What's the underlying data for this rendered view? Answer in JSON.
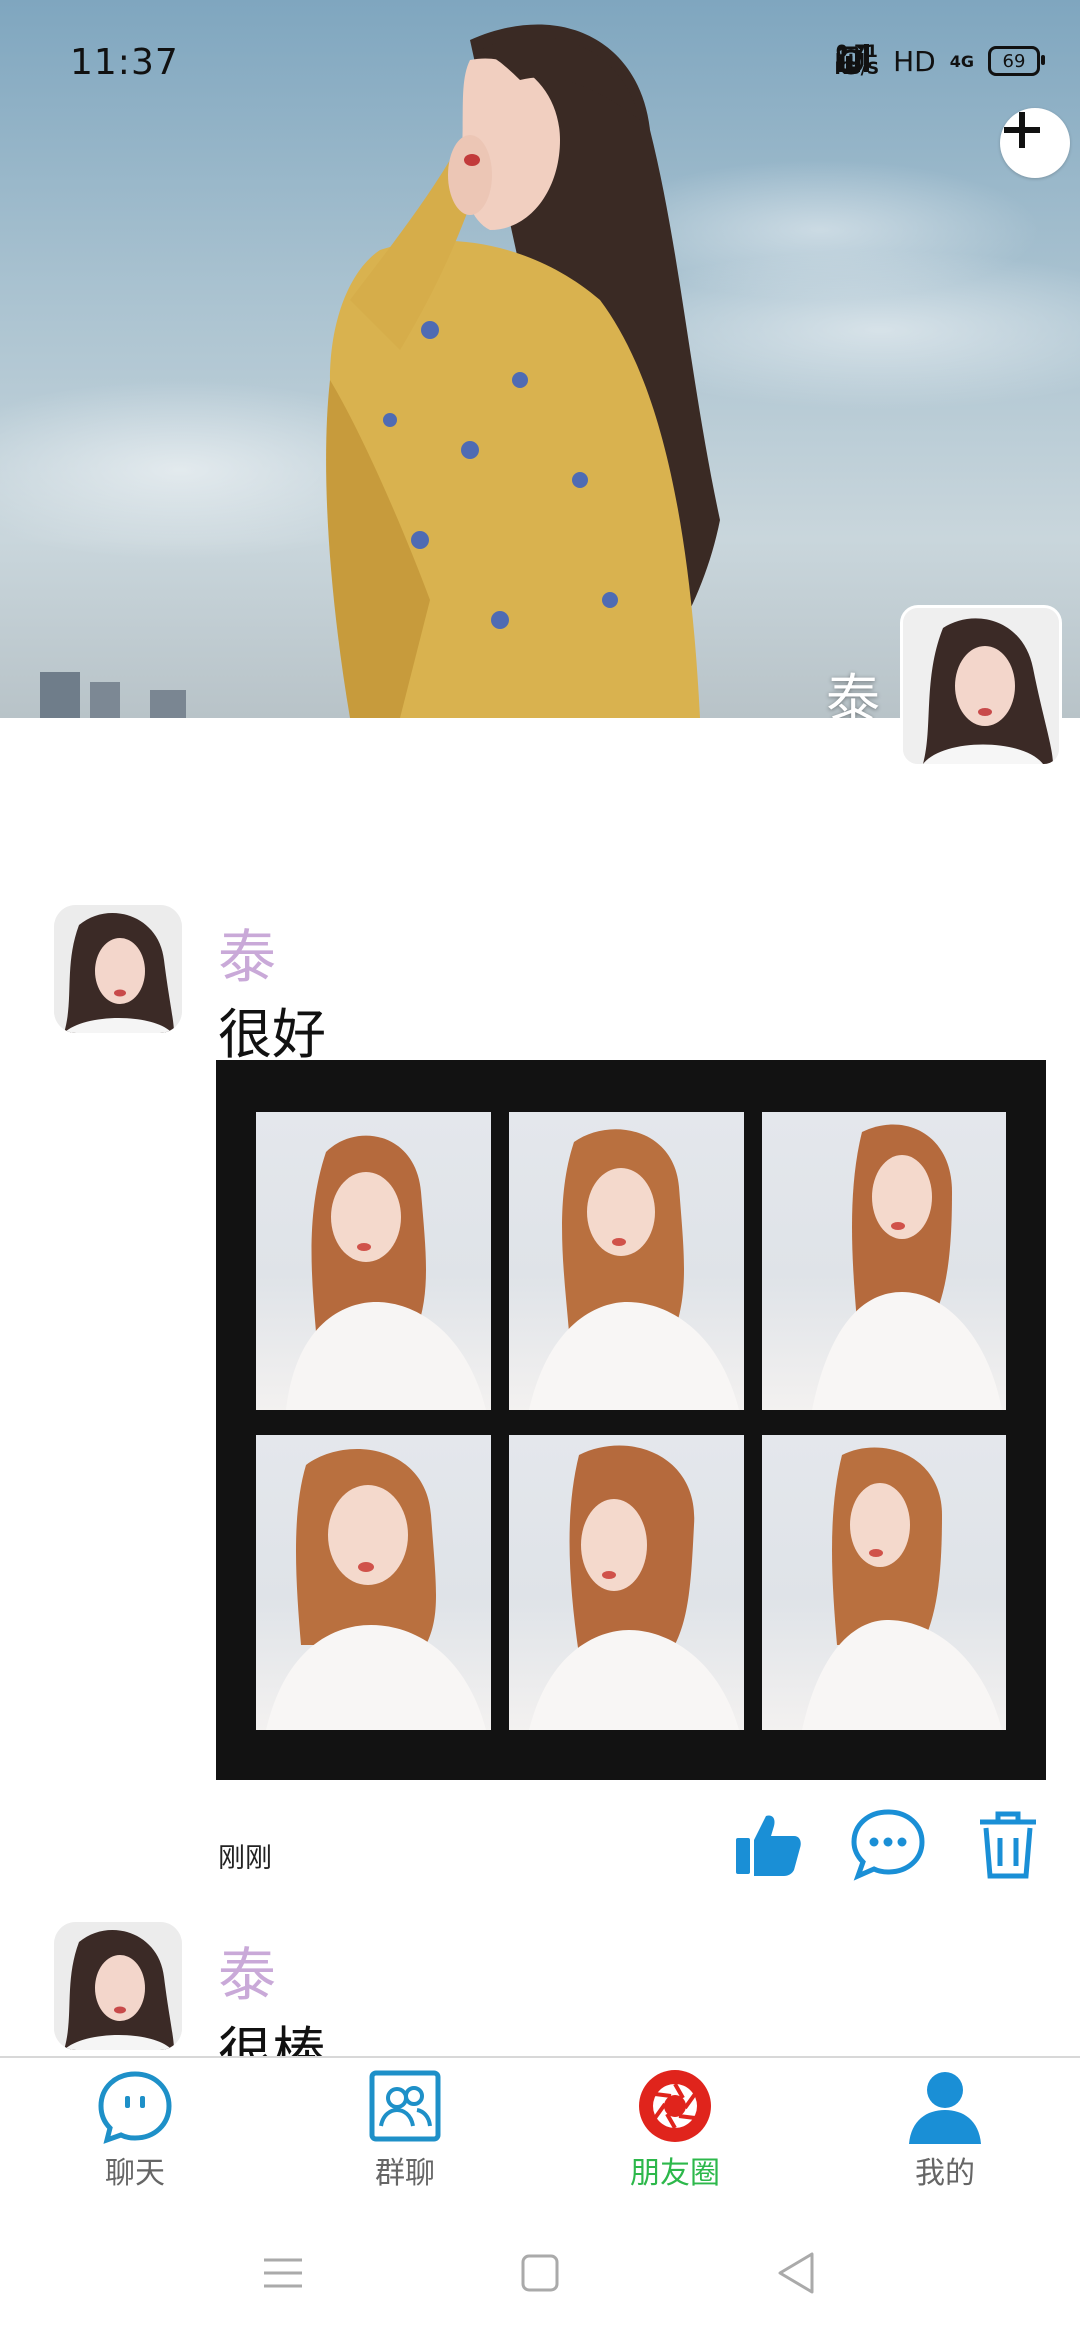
{
  "status_bar": {
    "time": "11:37",
    "net_speed_value": "0.71",
    "net_speed_unit": "KB/S",
    "hd": "HD",
    "network": "4G",
    "battery": "69"
  },
  "header": {
    "profile_name": "泰",
    "add_icon": "plus-icon"
  },
  "posts": [
    {
      "author": "泰",
      "text": "很好",
      "photos_count_shown": 6,
      "time": "刚刚",
      "actions": [
        "thumbs-up-icon",
        "comment-icon",
        "trash-icon"
      ]
    },
    {
      "author": "泰",
      "text": "很棒"
    }
  ],
  "bottom_nav": [
    {
      "label": "聊天",
      "icon": "chat-bubble-icon",
      "active": false
    },
    {
      "label": "群聊",
      "icon": "group-icon",
      "active": false
    },
    {
      "label": "朋友圈",
      "icon": "camera-aperture-icon",
      "active": true
    },
    {
      "label": "我的",
      "icon": "person-icon",
      "active": false
    }
  ],
  "system_nav": [
    "menu-icon",
    "home-icon",
    "back-icon"
  ],
  "colors": {
    "accent_active": "#2db84b",
    "author_name": "#c9a9d8",
    "icon_blue": "#1a8fd6",
    "moments_red": "#e0241c"
  }
}
